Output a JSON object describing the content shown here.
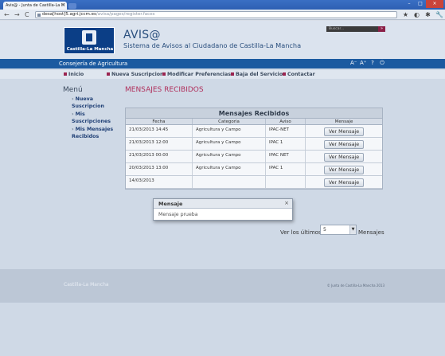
{
  "browser": {
    "tab_title": "Avis@ - Junta de Castilla-La M",
    "tab_close": "×",
    "url_host": "desa[host]5.agri.jccm.es",
    "url_path": "/avisa/pages/register.faces",
    "nav_back": "←",
    "nav_forward": "→",
    "nav_reload": "C",
    "win_min": "–",
    "win_max": "□",
    "win_close": "×",
    "icons": [
      "★",
      "◐",
      "✱",
      "🔧"
    ]
  },
  "header": {
    "logo_text": "Castilla-La Mancha",
    "title": "AVIS@",
    "subtitle": "Sistema de Avisos al Ciudadano de Castilla-La Mancha",
    "search_placeholder": "Buscar...",
    "search_button": "»"
  },
  "bluebar": {
    "consejeria": "Consejería de Agricultura",
    "icons": [
      "A⁻",
      "A⁺",
      "?",
      "⏻"
    ]
  },
  "menu": {
    "items": [
      "Inicio",
      "Nueva Suscripcion",
      "Modificar Preferencias",
      "Baja del Servicio",
      "Contactar"
    ]
  },
  "sidebar": {
    "title": "Menú",
    "links": [
      "Nueva",
      "Suscripcion",
      "Mis",
      "Suscripciones",
      "Mis Mensajes",
      "Recibidos"
    ]
  },
  "main": {
    "section_title": "MENSAJES RECIBIDOS",
    "table_caption": "Mensajes Recibidos",
    "columns": [
      "Fecha",
      "Categoria",
      "Aviso",
      "Mensaje"
    ],
    "rows": [
      {
        "fecha": "21/03/2013 14:45",
        "categoria": "Agricultura y Campo",
        "aviso": "IPAC-NET",
        "mensaje": "Ver Mensaje"
      },
      {
        "fecha": "21/03/2013 12:00",
        "categoria": "Agricultura y Campo",
        "aviso": "IPAC 1",
        "mensaje": "Ver Mensaje"
      },
      {
        "fecha": "21/03/2013 00:00",
        "categoria": "Agricultura y Campo",
        "aviso": "IPAC NET",
        "mensaje": "Ver Mensaje"
      },
      {
        "fecha": "20/03/2013 13:00",
        "categoria": "Agricultura y Campo",
        "aviso": "IPAC 1",
        "mensaje": "Ver Mensaje"
      },
      {
        "fecha": "14/03/2013",
        "categoria": "",
        "aviso": "",
        "mensaje": "Ver Mensaje"
      }
    ],
    "ver_ultimos_label": "Ver los últimos",
    "ver_ultimos_value": "5",
    "select_arrow": "▼",
    "mensajes_label": "Mensajes"
  },
  "modal": {
    "title": "Mensaje",
    "close": "×",
    "body": "Mensaje prueba"
  },
  "footer": {
    "logo_text": "Castilla-La Mancha",
    "copyright": "© Junta de Castilla-La Mancha 2013"
  }
}
